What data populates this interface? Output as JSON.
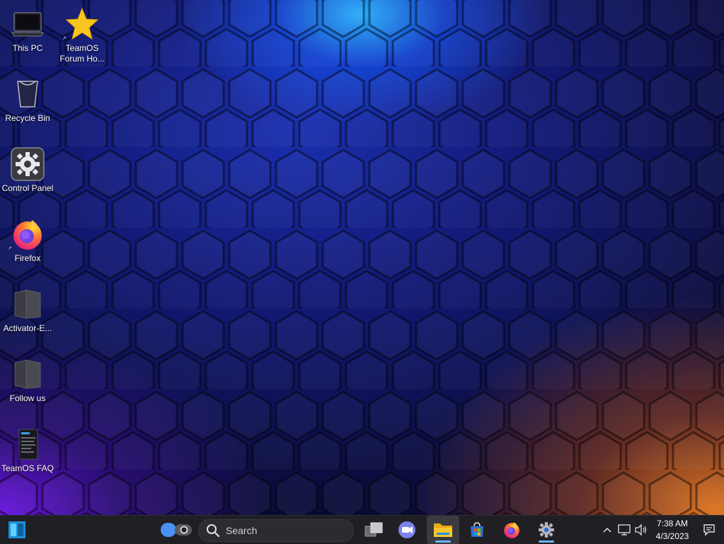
{
  "desktop": {
    "icons": [
      {
        "label": "This PC",
        "icon": "computer-icon"
      },
      {
        "label": "TeamOS Forum Ho...",
        "icon": "star-icon"
      },
      {
        "label": "Recycle Bin",
        "icon": "recycle-bin-icon"
      },
      {
        "label": "Control Panel",
        "icon": "control-panel-icon"
      },
      {
        "label": "Firefox",
        "icon": "firefox-icon"
      },
      {
        "label": "Activator-E...",
        "icon": "folder-icon"
      },
      {
        "label": "Follow us",
        "icon": "folder-icon"
      },
      {
        "label": "TeamOS FAQ",
        "icon": "document-icon"
      }
    ]
  },
  "taskbar": {
    "start_icon": "start-icon",
    "search": {
      "label": "Search",
      "icon": "search-icon"
    },
    "apps": [
      {
        "name": "Widgets",
        "icon": "widgets-icon"
      },
      {
        "name": "Task View",
        "icon": "task-view-icon"
      },
      {
        "name": "Meet",
        "icon": "video-chat-icon"
      },
      {
        "name": "File Explorer",
        "icon": "folder-icon",
        "active": true
      },
      {
        "name": "Microsoft Store",
        "icon": "store-icon"
      },
      {
        "name": "Firefox",
        "icon": "firefox-icon"
      },
      {
        "name": "Settings",
        "icon": "gear-icon",
        "active": true
      }
    ],
    "tray": {
      "time": "7:38 AM",
      "date": "4/3/2023",
      "icons": [
        "chevron-up-icon",
        "network-icon",
        "speaker-icon",
        "notification-icon"
      ]
    }
  },
  "colors": {
    "taskbar_bg": "#1f1f24",
    "accent": "#6cb4ff",
    "star": "#f7c51e"
  }
}
